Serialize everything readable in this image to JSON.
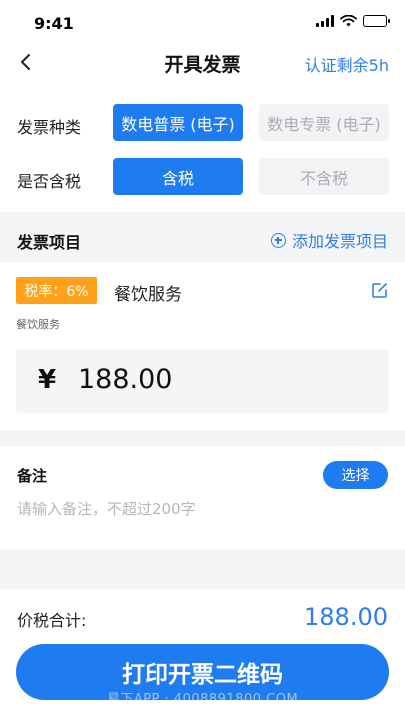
{
  "status_bar": {
    "time": "9:41"
  },
  "header": {
    "title": "开具发票",
    "right_text": "认证剩余5h"
  },
  "invoice_type": {
    "label": "发票种类",
    "options": [
      "数电普票 (电子)",
      "数电专票 (电子)"
    ],
    "selected": "数电普票 (电子)"
  },
  "tax_included": {
    "label": "是否含税",
    "options": [
      "含税",
      "不含税"
    ],
    "selected": "含税"
  },
  "items_section": {
    "title": "发票项目",
    "add_label": "添加发票项目"
  },
  "item": {
    "tax_badge": "税率：6%",
    "name": "餐饮服务",
    "sub_name": "餐饮服务",
    "currency": "¥",
    "amount": "188.00"
  },
  "remark": {
    "title": "备注",
    "select_label": "选择",
    "placeholder": "请输入备注，不超过200字",
    "value": ""
  },
  "total": {
    "label": "价税合计:",
    "value": "188.00"
  },
  "primary_button": {
    "label": "打印开票二维码"
  },
  "watermark": "易下APP · 4008891800.COM",
  "colors": {
    "accent": "#1f7bf0",
    "link": "#2f7ee6",
    "badge": "#ffa11a",
    "band": "#f4f5f7"
  },
  "icons": {
    "back": "chevron-left-icon",
    "add": "plus-circle-icon",
    "edit": "edit-icon"
  }
}
